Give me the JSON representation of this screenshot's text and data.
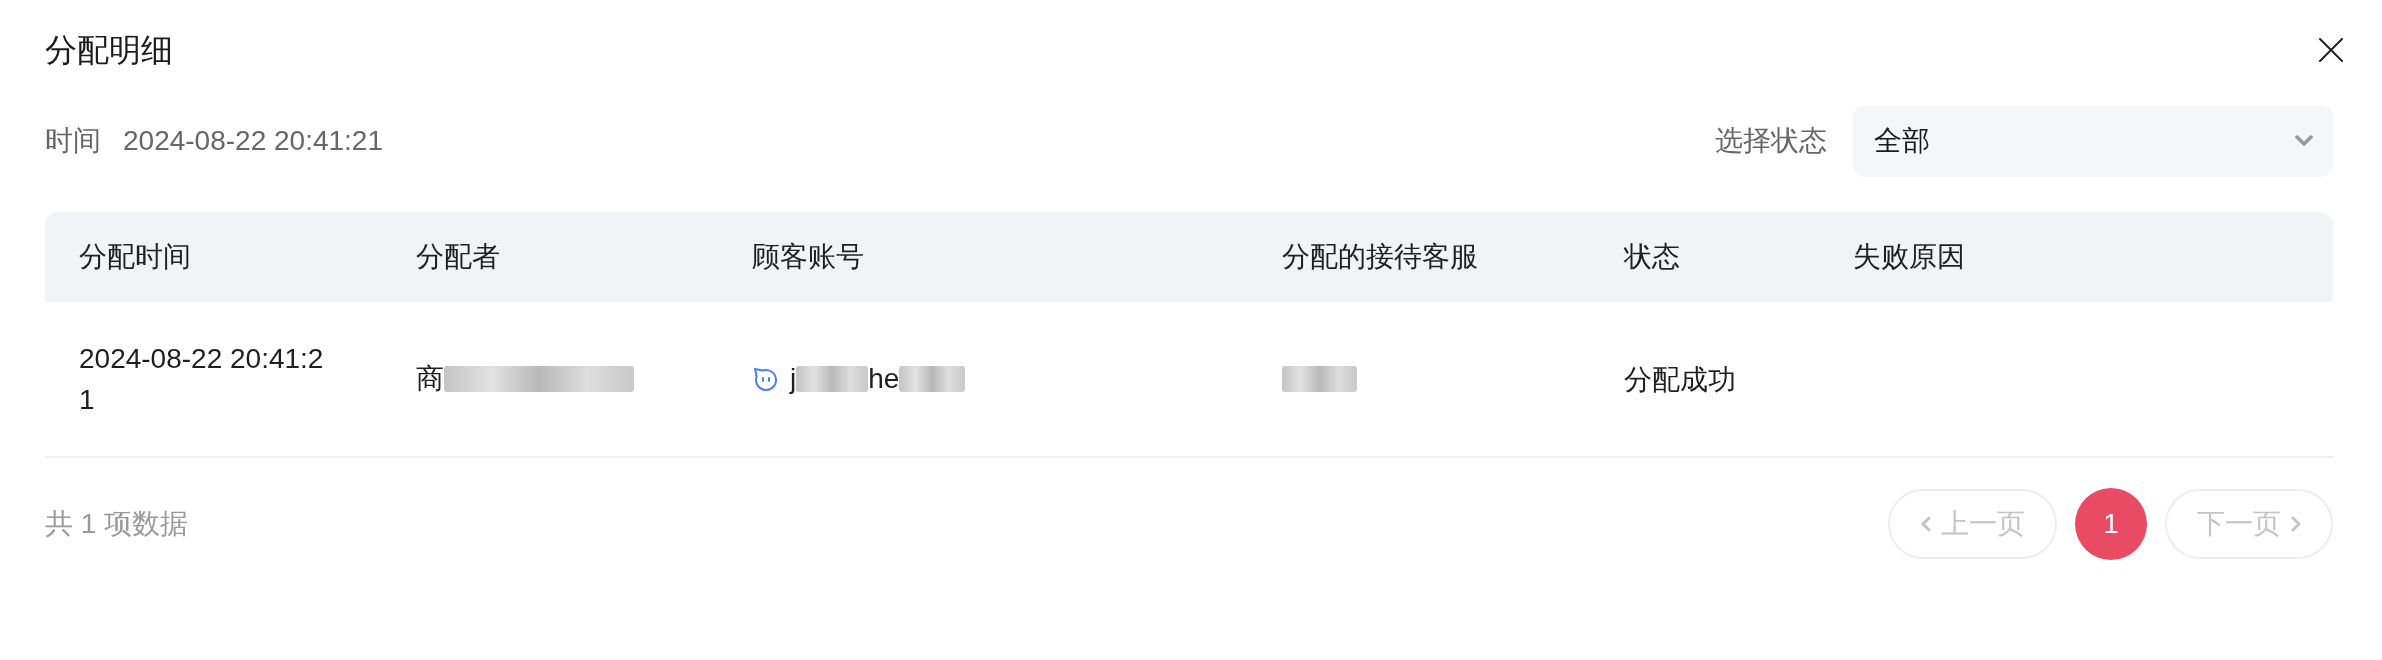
{
  "dialog": {
    "title": "分配明细"
  },
  "filters": {
    "time": {
      "label": "时间",
      "value": "2024-08-22 20:41:21"
    },
    "status": {
      "label": "选择状态",
      "value": "全部"
    }
  },
  "table": {
    "columns": [
      "分配时间",
      "分配者",
      "顾客账号",
      "分配的接待客服",
      "状态",
      "失败原因"
    ],
    "rows": [
      {
        "cells": [
          {
            "kind": "text",
            "text": "2024-08-22 20:41:21"
          },
          {
            "kind": "masked",
            "parts": [
              {
                "kind": "text",
                "text": "商"
              },
              {
                "kind": "blur"
              }
            ]
          },
          {
            "kind": "account",
            "parts": [
              {
                "kind": "text",
                "text": "j"
              },
              {
                "kind": "blur"
              },
              {
                "kind": "text",
                "text": "he"
              },
              {
                "kind": "blur"
              }
            ]
          },
          {
            "kind": "masked",
            "parts": [
              {
                "kind": "blur"
              }
            ]
          },
          {
            "kind": "text",
            "text": "分配成功"
          }
        ]
      }
    ]
  },
  "pagination": {
    "summary": "共 1 项数据",
    "prev": {
      "label": "上一页",
      "disabled": true
    },
    "pages": [
      {
        "label": "1",
        "selected": true
      }
    ],
    "next": {
      "label": "下一页",
      "disabled": true
    }
  }
}
